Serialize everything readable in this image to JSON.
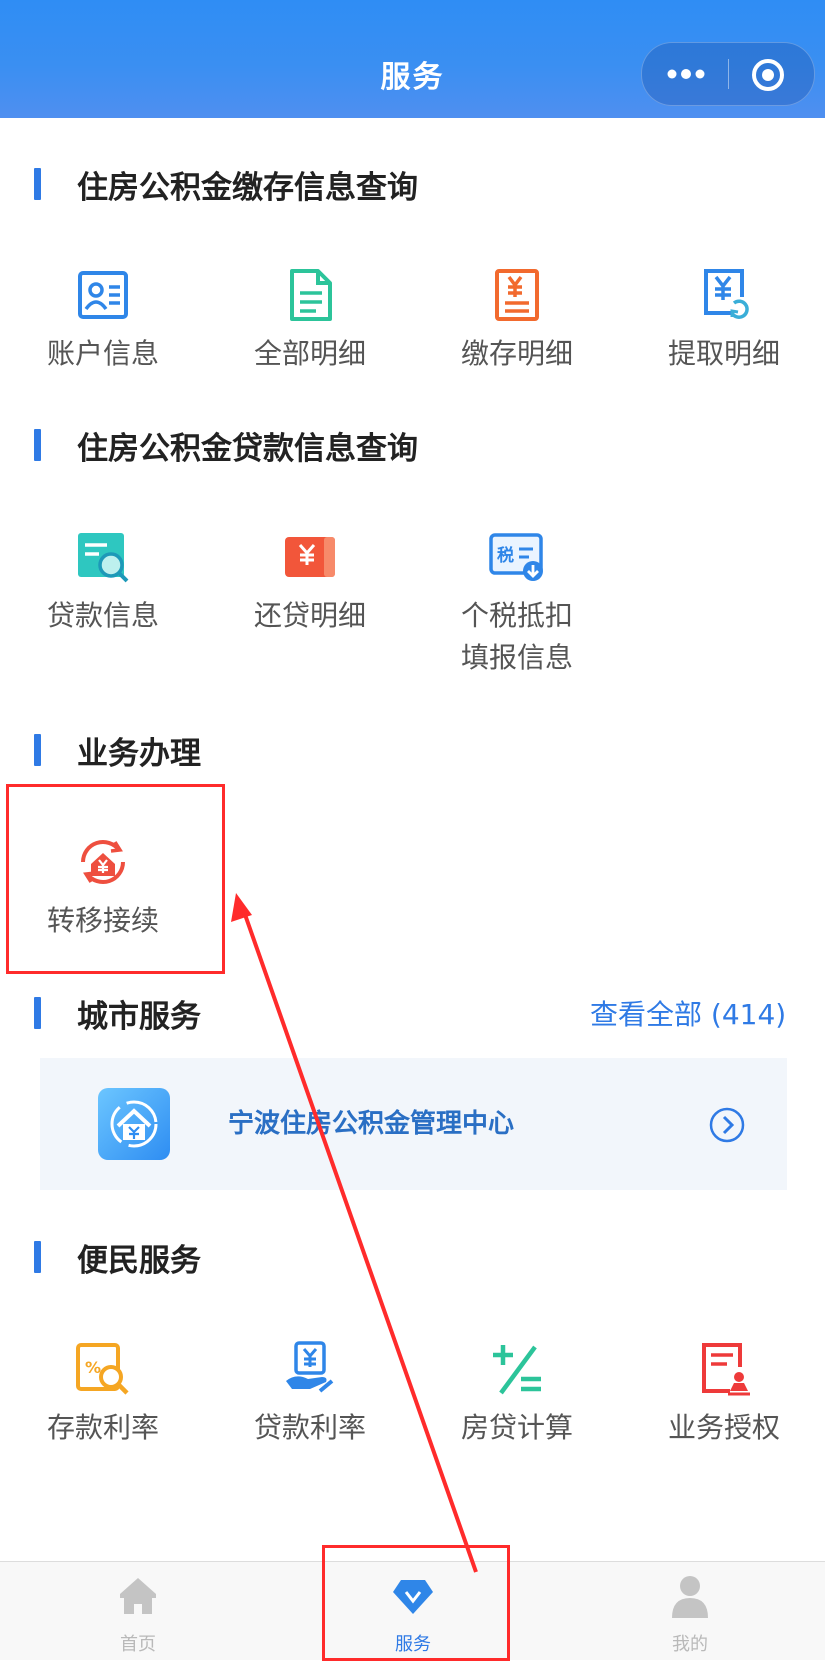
{
  "header": {
    "title": "服务"
  },
  "sections": {
    "deposit": {
      "title": "住房公积金缴存信息查询",
      "items": [
        {
          "label": "账户信息",
          "icon": "account-card-icon"
        },
        {
          "label": "全部明细",
          "icon": "document-list-icon"
        },
        {
          "label": "缴存明细",
          "icon": "yuan-receipt-icon"
        },
        {
          "label": "提取明细",
          "icon": "yuan-refresh-icon"
        }
      ]
    },
    "loan": {
      "title": "住房公积金贷款信息查询",
      "items": [
        {
          "label": "贷款信息",
          "icon": "search-document-icon"
        },
        {
          "label": "还贷明细",
          "icon": "yuan-wallet-icon"
        },
        {
          "label": "个税抵扣填报信息",
          "icon": "tax-download-icon"
        }
      ]
    },
    "business": {
      "title": "业务办理",
      "items": [
        {
          "label": "转移接续",
          "icon": "house-transfer-icon"
        }
      ]
    },
    "city": {
      "title": "城市服务",
      "view_all": "查看全部 (414)",
      "card_name": "宁波住房公积金管理中心"
    },
    "convenience": {
      "title": "便民服务",
      "items": [
        {
          "label": "存款利率",
          "icon": "percent-search-icon"
        },
        {
          "label": "贷款利率",
          "icon": "yuan-hand-icon"
        },
        {
          "label": "房贷计算",
          "icon": "calculator-icon"
        },
        {
          "label": "业务授权",
          "icon": "authorization-document-icon"
        }
      ]
    }
  },
  "tabbar": {
    "items": [
      {
        "label": "首页",
        "icon": "home-icon"
      },
      {
        "label": "服务",
        "icon": "diamond-service-icon",
        "active": true
      },
      {
        "label": "我的",
        "icon": "user-icon"
      }
    ]
  },
  "colors": {
    "accent": "#2f7ae5",
    "header": "#3a8ff2",
    "annotation": "#ff2b2b"
  }
}
